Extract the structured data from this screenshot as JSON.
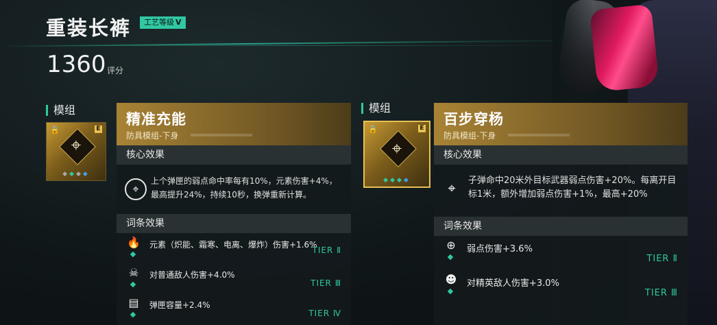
{
  "item": {
    "title": "重装长裤",
    "craft_label": "工艺等级",
    "craft_level": "V",
    "score": "1360",
    "score_label": "评分"
  },
  "left": {
    "section_label": "模组",
    "icon": "crosshair-icon",
    "rank": "E",
    "gems": [
      "grey",
      "teal",
      "grey",
      "blue"
    ],
    "card": {
      "name": "精准充能",
      "subtitle": "防具模组-下身",
      "core_title": "核心效果",
      "core_icon": "crosshair-icon",
      "core_text": "上个弹匣的弱点命中率每有10%，元素伤害+4%，最高提升24%，持续10秒，换弹重新计算。",
      "attr_title": "词条效果",
      "attrs": [
        {
          "icon": "element-flame-icon",
          "text": "元素（炽能、霜寒、电离、爆炸）伤害+1.6%",
          "tier": "TIER Ⅱ"
        },
        {
          "icon": "enemy-icon",
          "text": "对普通敌人伤害+4.0%",
          "tier": "TIER Ⅲ"
        },
        {
          "icon": "magazine-icon",
          "text": "弹匣容量+2.4%",
          "tier": "TIER Ⅳ"
        }
      ]
    }
  },
  "right": {
    "section_label": "模组",
    "icon": "sniper-rifle-icon",
    "rank": "E",
    "gems": [
      "teal",
      "teal",
      "teal",
      "blue"
    ],
    "card": {
      "name": "百步穿杨",
      "subtitle": "防具模组-下身",
      "core_title": "核心效果",
      "core_icon": "sniper-rifle-icon",
      "core_text": "子弹命中20米外目标武器弱点伤害+20%。每离开目标1米，额外增加弱点伤害+1%，最高+20%",
      "attr_title": "词条效果",
      "attrs": [
        {
          "icon": "weakpoint-icon",
          "text": "弱点伤害+3.6%",
          "tier": "TIER Ⅱ"
        },
        {
          "icon": "elite-enemy-icon",
          "text": "对精英敌人伤害+3.0%",
          "tier": "TIER Ⅲ"
        }
      ]
    }
  },
  "colors": {
    "accent": "#2fc8a2",
    "gold": "#a88335",
    "gem_blue": "#3ea0e8"
  }
}
